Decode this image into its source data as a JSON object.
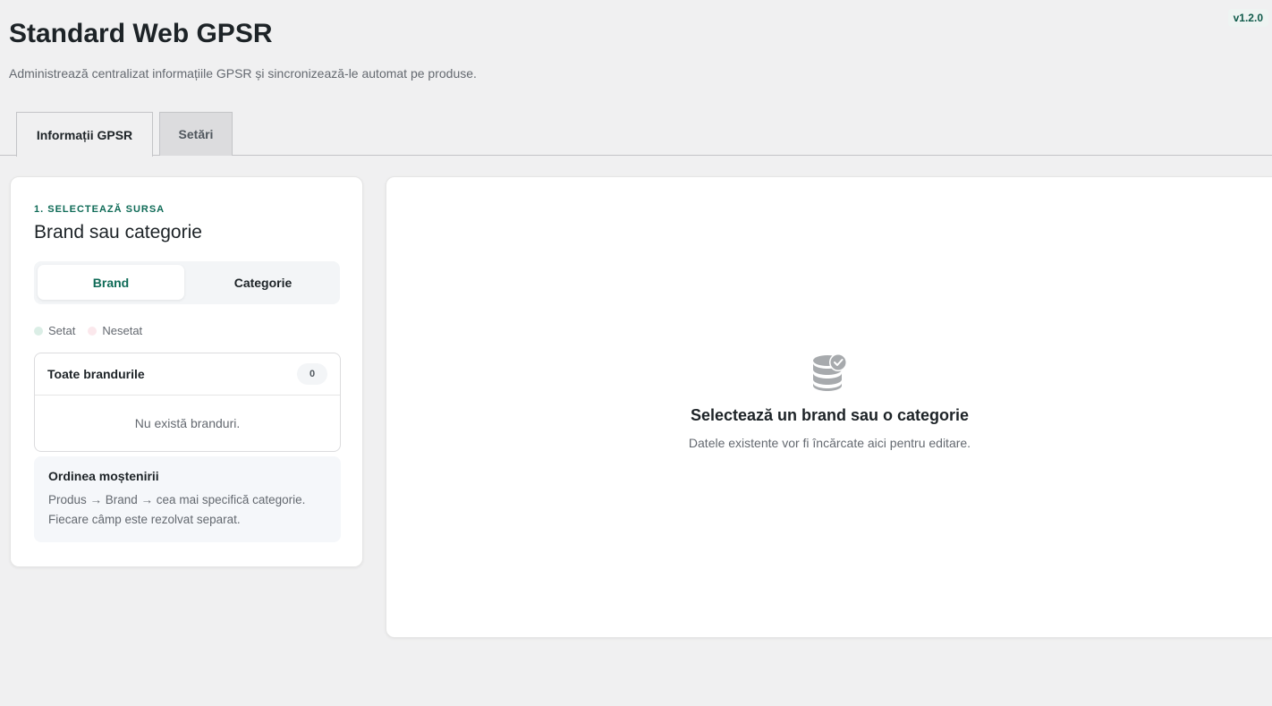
{
  "version": "v1.2.0",
  "header": {
    "title": "Standard Web GPSR",
    "subtitle": "Administrează centralizat informațiile GPSR și sincronizează-le automat pe produse."
  },
  "tabs": [
    {
      "label": "Informații GPSR",
      "active": true
    },
    {
      "label": "Setări",
      "active": false
    }
  ],
  "source_panel": {
    "step_label": "1. SELECTEAZĂ SURSA",
    "title": "Brand sau categorie",
    "toggle": [
      {
        "label": "Brand",
        "active": true
      },
      {
        "label": "Categorie",
        "active": false
      }
    ],
    "legend": {
      "set": "Setat",
      "unset": "Nesetat"
    },
    "list": {
      "header": "Toate brandurile",
      "count": "0",
      "empty_text": "Nu există branduri."
    },
    "inheritance": {
      "title": "Ordinea moștenirii",
      "line1": "Produs → Brand → cea mai specifică categorie.",
      "line2": "Fiecare câmp este rezolvat separat."
    }
  },
  "editor_panel": {
    "icon": "database-check-icon",
    "empty_title": "Selectează un brand sau o categorie",
    "empty_subtitle": "Datele existente vor fi încărcate aici pentru editare."
  },
  "colors": {
    "accent": "#0f6b57",
    "background": "#f0f0f1",
    "set_dot": "#dbeee6",
    "unset_dot": "#fbe8ec"
  }
}
